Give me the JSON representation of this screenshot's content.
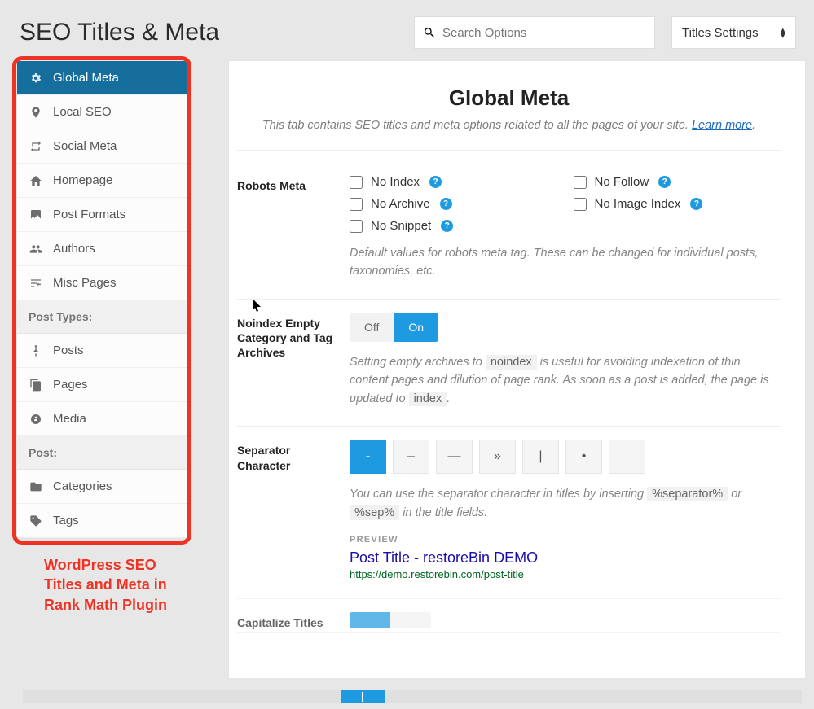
{
  "header": {
    "title": "SEO Titles & Meta",
    "search_placeholder": "Search Options",
    "dropdown_label": "Titles Settings"
  },
  "sidebar": {
    "items": [
      {
        "label": "Global Meta",
        "icon": "gear-icon",
        "active": true
      },
      {
        "label": "Local SEO",
        "icon": "pin-icon"
      },
      {
        "label": "Social Meta",
        "icon": "retweet-icon"
      },
      {
        "label": "Homepage",
        "icon": "home-icon"
      },
      {
        "label": "Post Formats",
        "icon": "image-icon"
      },
      {
        "label": "Authors",
        "icon": "users-icon"
      },
      {
        "label": "Misc Pages",
        "icon": "sliders-icon"
      }
    ],
    "group_post_types": "Post Types:",
    "post_types": [
      {
        "label": "Posts",
        "icon": "pin2-icon"
      },
      {
        "label": "Pages",
        "icon": "copy-icon"
      },
      {
        "label": "Media",
        "icon": "media-icon"
      }
    ],
    "group_post": "Post:",
    "post_tax": [
      {
        "label": "Categories",
        "icon": "folder-icon"
      },
      {
        "label": "Tags",
        "icon": "tag-icon"
      }
    ]
  },
  "annotation": "WordPress SEO Titles and Meta in Rank Math Plugin",
  "main": {
    "title": "Global Meta",
    "subtitle": "This tab contains SEO titles and meta options related to all the pages of your site.",
    "learn_more": "Learn more",
    "robots_label": "Robots Meta",
    "robots": {
      "noindex": "No Index",
      "nofollow": "No Follow",
      "noarchive": "No Archive",
      "noimageindex": "No Image Index",
      "nosnippet": "No Snippet"
    },
    "robots_desc": "Default values for robots meta tag. These can be changed for individual posts, taxonomies, etc.",
    "noindex_label": "Noindex Empty Category and Tag Archives",
    "toggle_off": "Off",
    "toggle_on": "On",
    "noindex_desc_1": "Setting empty archives to",
    "noindex_desc_code1": "noindex",
    "noindex_desc_2": "is useful for avoiding indexation of thin content pages and dilution of page rank. As soon as a post is added, the page is updated to",
    "noindex_desc_code2": "index",
    "sep_label": "Separator Character",
    "separators": [
      "-",
      "–",
      "—",
      "»",
      "|",
      "•",
      ""
    ],
    "sep_desc_1": "You can use the separator character in titles by inserting",
    "sep_code_1": "%separator%",
    "sep_desc_2": "or",
    "sep_code_2": "%sep%",
    "sep_desc_3": "in the title fields.",
    "preview_label": "PREVIEW",
    "preview_title": "Post Title - restoreBin DEMO",
    "preview_url": "https://demo.restorebin.com/post-title",
    "capitalize_label": "Capitalize Titles"
  }
}
